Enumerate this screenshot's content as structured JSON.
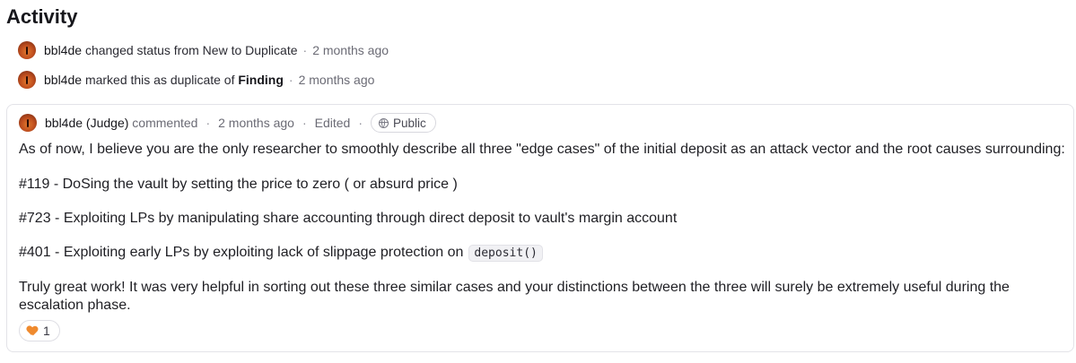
{
  "page": {
    "title": "Activity"
  },
  "events": [
    {
      "user": "bbl4de",
      "prefix": "changed status from New to Duplicate",
      "time": "2 months ago"
    },
    {
      "user": "bbl4de",
      "prefix": "marked this as duplicate of",
      "link": "Finding",
      "time": "2 months ago"
    }
  ],
  "comment": {
    "author": "bbl4de (Judge)",
    "action": "commented",
    "time": "2 months ago",
    "edited": "Edited",
    "visibility": "Public",
    "intro": "As of now, I believe you are the only researcher to smoothly describe all three \"edge cases\" of the initial deposit as an attack vector and the root causes surrounding:",
    "items": [
      {
        "text": "#119 - DoSing the vault by setting the price to zero ( or absurd price )"
      },
      {
        "text": "#723 - Exploiting LPs by manipulating share accounting through direct deposit to vault's margin account"
      },
      {
        "text": "#401 - Exploiting early LPs by exploiting lack of slippage protection on",
        "code": "deposit()"
      }
    ],
    "closing": "Truly great work! It was very helpful in sorting out these three similar cases and your distinctions between the three will surely be extremely useful during the escalation phase.",
    "reaction": {
      "icon": "orange-heart-icon",
      "count": "1",
      "color": "#ef8a2e"
    }
  }
}
